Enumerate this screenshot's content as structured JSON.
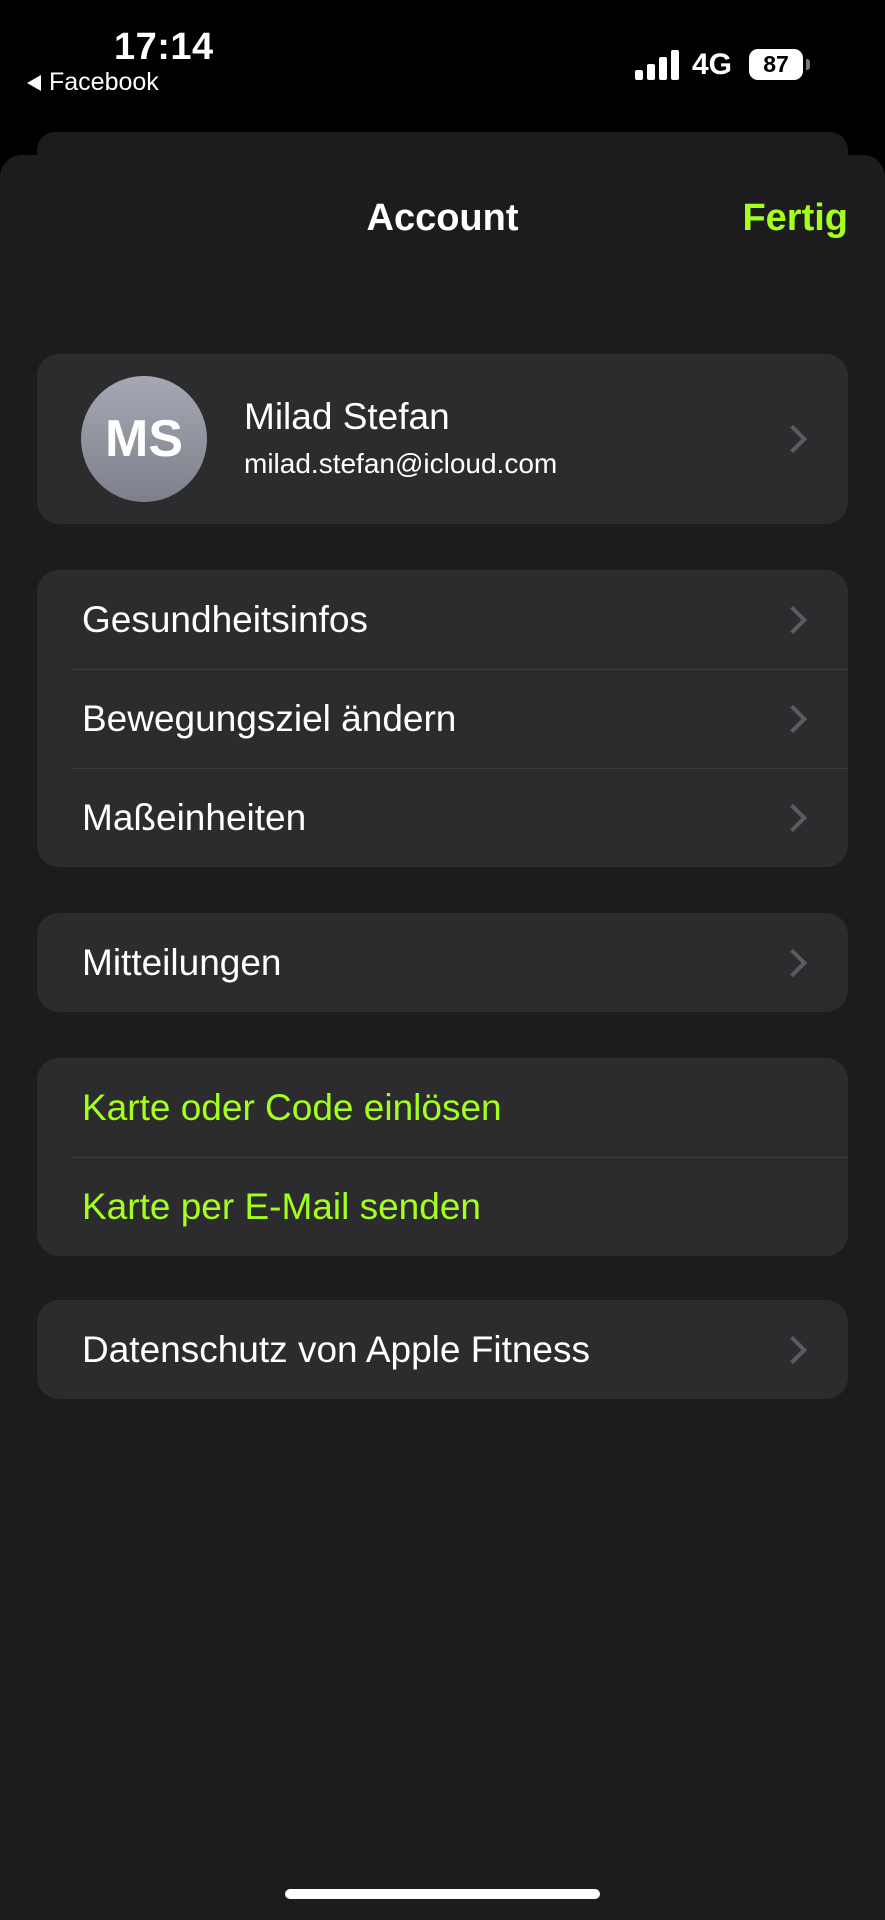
{
  "status_bar": {
    "time": "17:14",
    "back_app": "Facebook",
    "network": "4G",
    "battery": "87"
  },
  "header": {
    "title": "Account",
    "done_label": "Fertig",
    "accent_color": "#a4ff1d"
  },
  "profile": {
    "initials": "MS",
    "name": "Milad Stefan",
    "email": "milad.stefan@icloud.com"
  },
  "settings_group": [
    {
      "label": "Gesundheitsinfos"
    },
    {
      "label": "Bewegungsziel ändern"
    },
    {
      "label": "Maßeinheiten"
    }
  ],
  "notifications": {
    "label": "Mitteilungen"
  },
  "card_group": [
    {
      "label": "Karte oder Code einlösen"
    },
    {
      "label": "Karte per E-Mail senden"
    }
  ],
  "privacy": {
    "label": "Datenschutz von Apple Fitness"
  }
}
